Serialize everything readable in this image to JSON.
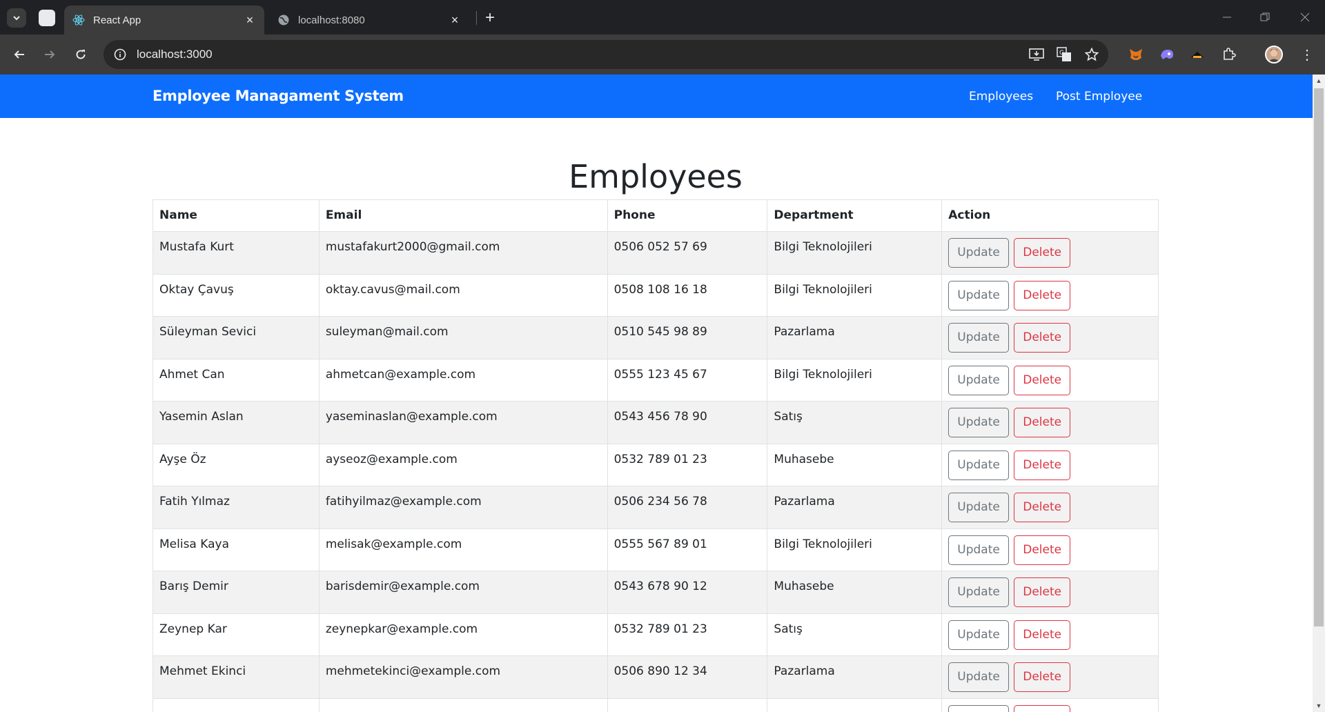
{
  "browser": {
    "tabs": [
      {
        "title": "React App",
        "active": true
      },
      {
        "title": "localhost:8080",
        "active": false
      }
    ],
    "url": "localhost:3000"
  },
  "navbar": {
    "brand": "Employee Managament System",
    "links": [
      "Employees",
      "Post Employee"
    ],
    "color": "#0d6efd"
  },
  "page": {
    "title": "Employees"
  },
  "table": {
    "headers": [
      "Name",
      "Email",
      "Phone",
      "Department",
      "Action"
    ],
    "update_label": "Update",
    "delete_label": "Delete",
    "rows": [
      {
        "name": "Mustafa Kurt",
        "email": "mustafakurt2000@gmail.com",
        "phone": "0506 052 57 69",
        "department": "Bilgi Teknolojileri"
      },
      {
        "name": "Oktay Çavuş",
        "email": "oktay.cavus@mail.com",
        "phone": "0508 108 16 18",
        "department": "Bilgi Teknolojileri"
      },
      {
        "name": "Süleyman Sevici",
        "email": "suleyman@mail.com",
        "phone": "0510 545 98 89",
        "department": "Pazarlama"
      },
      {
        "name": "Ahmet Can",
        "email": "ahmetcan@example.com",
        "phone": "0555 123 45 67",
        "department": "Bilgi Teknolojileri"
      },
      {
        "name": "Yasemin Aslan",
        "email": "yaseminaslan@example.com",
        "phone": "0543 456 78 90",
        "department": "Satış"
      },
      {
        "name": "Ayşe Öz",
        "email": "ayseoz@example.com",
        "phone": "0532 789 01 23",
        "department": "Muhasebe"
      },
      {
        "name": "Fatih Yılmaz",
        "email": "fatihyilmaz@example.com",
        "phone": "0506 234 56 78",
        "department": "Pazarlama"
      },
      {
        "name": "Melisa Kaya",
        "email": "melisak@example.com",
        "phone": "0555 567 89 01",
        "department": "Bilgi Teknolojileri"
      },
      {
        "name": "Barış Demir",
        "email": "barisdemir@example.com",
        "phone": "0543 678 90 12",
        "department": "Muhasebe"
      },
      {
        "name": "Zeynep Kar",
        "email": "zeynepkar@example.com",
        "phone": "0532 789 01 23",
        "department": "Satış"
      },
      {
        "name": "Mehmet Ekinci",
        "email": "mehmetekinci@example.com",
        "phone": "0506 890 12 34",
        "department": "Pazarlama"
      },
      {
        "name": "",
        "email": "",
        "phone": "",
        "department": ""
      }
    ]
  },
  "icons": [
    "tab-search-icon",
    "react-icon",
    "globe-icon",
    "close-icon",
    "plus-icon",
    "back-icon",
    "forward-icon",
    "reload-icon",
    "site-info-icon",
    "install-icon",
    "translate-icon",
    "star-icon",
    "metamask-icon",
    "extension-purple-icon",
    "extension-dark-icon",
    "puzzle-icon",
    "profile-avatar",
    "menu-icon"
  ]
}
